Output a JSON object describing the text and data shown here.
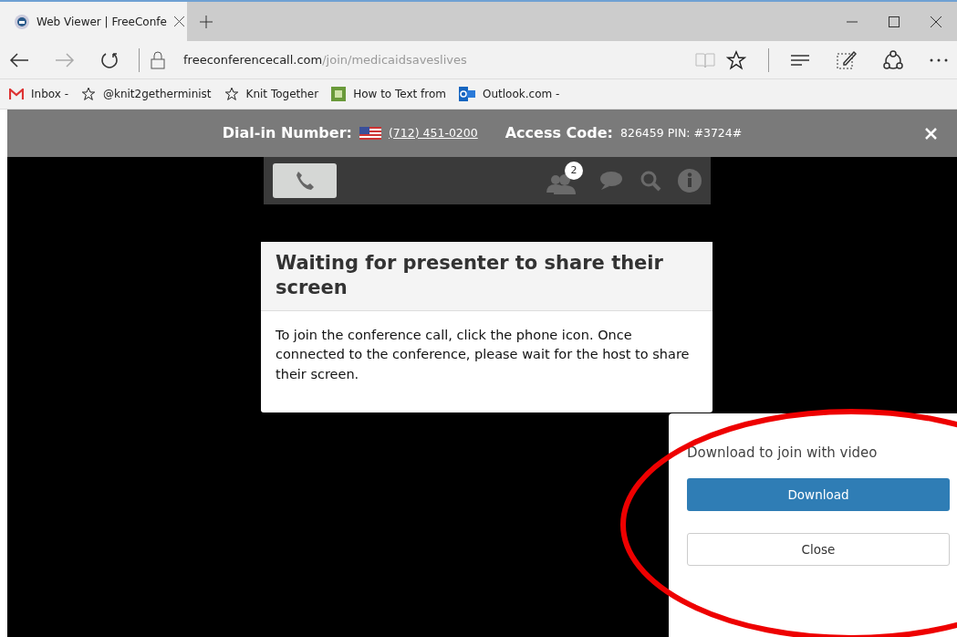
{
  "browser": {
    "tab": {
      "title": "Web Viewer | FreeConfe",
      "selected": true
    },
    "address": {
      "host": "freeconferencecall.com",
      "path": "/join/medicaidsaveslives"
    },
    "bookmarks": [
      {
        "kind": "gmail",
        "label": "Inbox -"
      },
      {
        "kind": "star",
        "label": "@knit2getherminist"
      },
      {
        "kind": "star",
        "label": "Knit Together"
      },
      {
        "kind": "wh",
        "label": "How to Text from"
      },
      {
        "kind": "outlook",
        "label": "Outlook.com -"
      }
    ]
  },
  "dial_bar": {
    "dial_label": "Dial-in Number:",
    "dial_number": "(712) 451-0200",
    "access_label": "Access Code:",
    "access_value": "826459 PIN: #3724#"
  },
  "toolbar": {
    "participants_count": "2"
  },
  "card": {
    "title": "Waiting for presenter to share their screen",
    "body": "To join the conference call, click the phone icon. Once connected to the conference, please wait for the host to share their screen."
  },
  "popup": {
    "text": "Download to join with video",
    "download": "Download",
    "close": "Close"
  }
}
